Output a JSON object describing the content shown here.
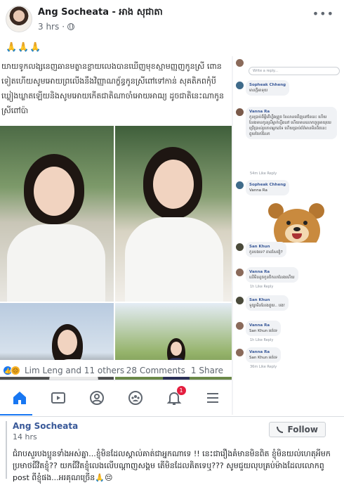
{
  "post": {
    "author": "Ang Socheata - អាង សុជាតា",
    "time": "3 hrs",
    "more": "•••",
    "caption": "🙏🙏🙏"
  },
  "screenshot": {
    "khmer_paragraph": "យាយទូកលង្សនេញឆានមត្ខានខ្លាយលេងបានឃើញមុខស្មាមញ្ញញកូនស្រី ពោនទៀតហើយសូមអោយព្រលើងនឹងវិញ្ញាណក្ខ័ន្ធកូនស្រីពៅទៅកាន់ សុគតិភពកុំបីឃ្លៀងឃ្លាតឡើយនិងសូមអោយកើតជាតិណាចាំអោយអាឍ្យ ដូចជាតិនេះណាកូនស្រីពៅប៉ា",
    "reactions_text": "Lim Leng and 11 others",
    "comments_count": "28 Comments",
    "shares_count": "1 Share",
    "notification_badge": "1",
    "comments": [
      {
        "name": "",
        "text": "",
        "actions": "Write a reply..."
      },
      {
        "name": "Sopheak Chheng",
        "text": "មានក្តីអាទុយ",
        "actions": ""
      },
      {
        "name": "Vanna Ra",
        "text": "កូនប្រាប់ពីអ្វីតើហ្នឹងគ្រួច ខែលានឃើញនៅខែនេះ ហើយលែងមានកូនស្រីម្នាក់ហ្នឹងនៅ ហើយមានលោកពូឬអាយុយេ ប្រើប្រាស់រូបភាពអ្នកដទៃ ហើយប្រាប់ព័ត៌មានមិនពិតនេះ ជួយចែករំលែក",
        "actions": "54m Like Reply"
      },
      {
        "name": "Sopheak Chheng",
        "text": "Vanna Ra",
        "actions": ""
      },
      {
        "name": "San Khun",
        "text": "កូនបងទេ? តាដសែវៀ?",
        "actions": ""
      },
      {
        "name": "Vanna Ra",
        "text": "លើមិនដូចកូនចិកលាលែងហើយ",
        "actions": "1h Like Reply"
      },
      {
        "name": "San Khun",
        "text": "ទូច្បាមិនលែងជួយ.. បង!",
        "actions": ""
      },
      {
        "name": "Vanna Ra",
        "text": "San Khun អត់ទេ",
        "actions": "1h Like Reply"
      },
      {
        "name": "Vanna Ra",
        "text": "San Khun អត់ទេ",
        "actions": "36m Like Reply"
      }
    ]
  },
  "bottom_comment": {
    "author": "Ang Socheata",
    "time": "14 hrs",
    "follow_label": "Follow",
    "text": "ជំរាបសួរបងប្អូនទាំងអស់គ្នា...ខ្ញុំមិនដែលស្គាល់គាត់ជាអ្នកណាទេ !! នេះជារឿងគំមានមិនពិត ខ្ញុំមិនយល់ហេតុអីមកប្រមាថជីវិតខ្ញុំ?? យកជីវិតខ្ញុំលេងលើបណ្តាញសង្គម តើមិនដែលគិតទេឬ??? សូមជួយលុបគ្រប់ម៉ាងដែលលោកពូ post ពីខ្ញុំផង...អរគុណច្រើន🙏😔"
  },
  "colors": {
    "fb_blue": "#1877f2",
    "link_blue": "#385898",
    "badge_red": "#e41e3f"
  }
}
